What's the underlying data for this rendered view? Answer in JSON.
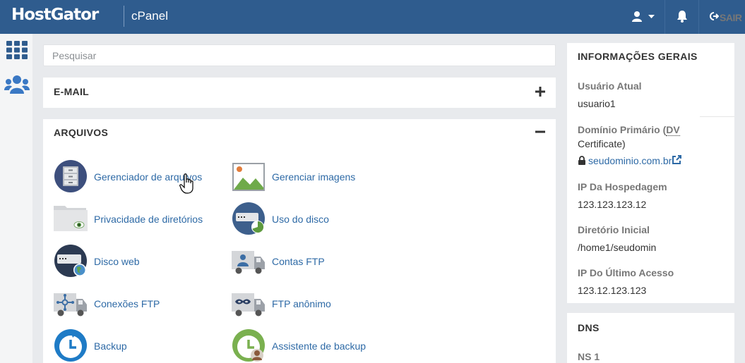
{
  "header": {
    "brand": "HostGator",
    "product": "cPanel",
    "logout_label": "SAIR"
  },
  "search": {
    "placeholder": "Pesquisar"
  },
  "sections": {
    "email": {
      "title": "E-MAIL"
    },
    "files": {
      "title": "ARQUIVOS",
      "items": [
        {
          "label": "Gerenciador de arquivos",
          "icon": "file-manager-icon"
        },
        {
          "label": "Gerenciar imagens",
          "icon": "images-icon"
        },
        {
          "label": "Privacidade de diretórios",
          "icon": "directory-privacy-icon"
        },
        {
          "label": "Uso do disco",
          "icon": "disk-usage-icon"
        },
        {
          "label": "Disco web",
          "icon": "web-disk-icon"
        },
        {
          "label": "Contas FTP",
          "icon": "ftp-accounts-icon"
        },
        {
          "label": "Conexões FTP",
          "icon": "ftp-connections-icon"
        },
        {
          "label": "FTP anônimo",
          "icon": "anonymous-ftp-icon"
        },
        {
          "label": "Backup",
          "icon": "backup-icon"
        },
        {
          "label": "Assistente de backup",
          "icon": "backup-wizard-icon"
        }
      ]
    }
  },
  "general_info": {
    "title": "INFORMAÇÕES GERAIS",
    "current_user_label": "Usuário Atual",
    "current_user": "usuario1",
    "primary_domain_label_a": "Domínio Primário (",
    "primary_domain_label_dv": "DV",
    "primary_domain_label_b": "Certificate)",
    "primary_domain": "seudominio.com.br",
    "hosting_ip_label": "IP Da Hospedagem",
    "hosting_ip": "123.123.123.12",
    "home_dir_label": "Diretório Inicial",
    "home_dir": "/home1/seudomin",
    "last_ip_label": "IP Do Último Acesso",
    "last_ip": "123.12.123.123"
  },
  "dns": {
    "title": "DNS",
    "ns1_label": "NS 1"
  },
  "colors": {
    "header": "#2f5c8e",
    "link": "#2e6aa6",
    "background": "#e8eaed"
  }
}
